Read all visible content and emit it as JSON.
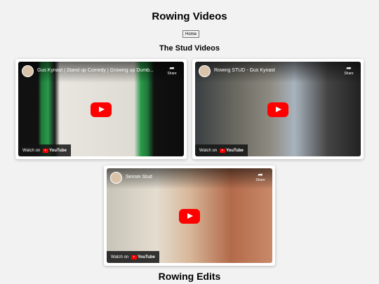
{
  "page": {
    "title": "Rowing Videos",
    "home_button": "Home",
    "section_studs": "The Stud Videos",
    "section_edits": "Rowing Edits"
  },
  "videos": [
    {
      "title": "Gus Kynast | Stand up Comedy | Growing up Dumb...",
      "share_label": "Share",
      "watch_label": "Watch on",
      "logo_text": "YouTube"
    },
    {
      "title": "Rowing STUD - Gus Kynast",
      "share_label": "Share",
      "watch_label": "Watch on",
      "logo_text": "YouTube"
    },
    {
      "title": "Sensei Stud",
      "share_label": "Share",
      "watch_label": "Watch on",
      "logo_text": "YouTube"
    }
  ],
  "colors": {
    "background": "#f2f2f2",
    "play_button": "#ff0000"
  },
  "icons": [
    "avatar",
    "share-icon",
    "play-icon",
    "youtube-logo-icon"
  ]
}
